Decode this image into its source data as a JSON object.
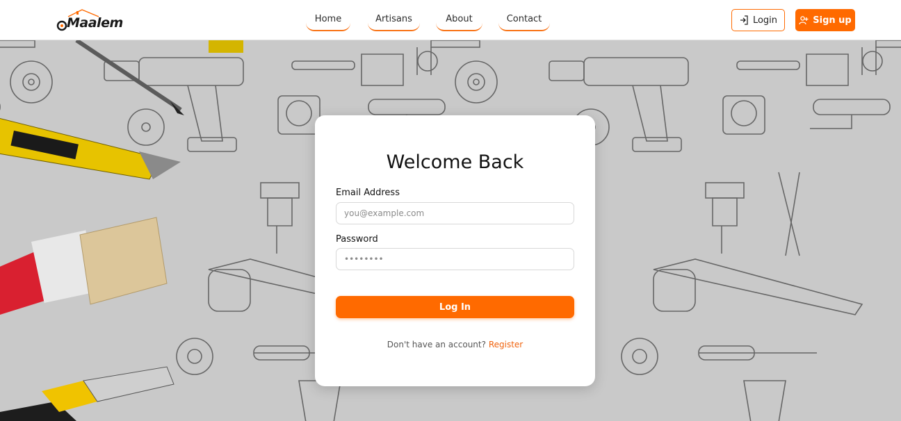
{
  "brand": {
    "name": "Maalem"
  },
  "nav": {
    "links": [
      {
        "label": "Home"
      },
      {
        "label": "Artisans"
      },
      {
        "label": "About"
      },
      {
        "label": "Contact"
      }
    ],
    "login_label": "Login",
    "signup_label": "Sign up"
  },
  "form": {
    "title": "Welcome Back",
    "email_label": "Email Address",
    "email_placeholder": "you@example.com",
    "password_label": "Password",
    "password_placeholder": "••••••••",
    "submit_label": "Log In",
    "register_prompt": "Don't have an account?",
    "register_link": "Register"
  },
  "colors": {
    "accent": "#ff6a00",
    "background": "#c9c9c9",
    "line_art": "#666666"
  },
  "icons": [
    "house-roof-icon",
    "login-arrow-icon",
    "user-plus-icon"
  ]
}
